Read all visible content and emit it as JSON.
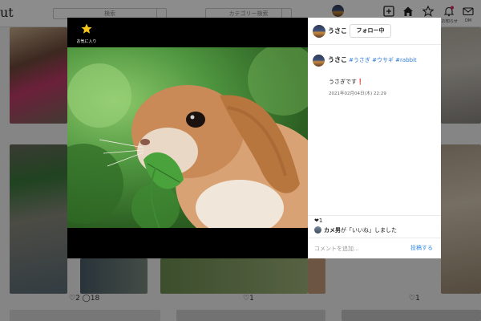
{
  "app": {
    "logo_text": "ut"
  },
  "header": {
    "search_placeholder": "検索",
    "category_placeholder": "カテゴリー検索",
    "nav": [
      {
        "label": "",
        "icon": "plus-square-icon"
      },
      {
        "label": "",
        "icon": "home-icon"
      },
      {
        "label": "",
        "icon": "star-icon"
      },
      {
        "label": "お知らせ",
        "icon": "bell-icon"
      },
      {
        "label": "DM",
        "icon": "mail-icon"
      }
    ]
  },
  "grid_meta": {
    "item1_stats": "♡2 ◯18",
    "item2_stats": "♡1",
    "item3_stats": "♡1"
  },
  "modal": {
    "favorite_label": "お気に入り",
    "author": "うさこ",
    "follow_label": "フォロー中",
    "post_author": "うさこ",
    "hashtags": "#うさぎ #ウサギ #rabbit",
    "caption": "うさぎです❗",
    "timestamp": "2021年02月04日(木) 22:29",
    "like_count": "❤1",
    "liked_by_user": "カメ男",
    "liked_by_text": "が「いいね」しました",
    "comment_placeholder": "コメントを追加...",
    "post_button": "投稿する"
  },
  "colors": {
    "accent": "#3a8fe8",
    "star": "#f5c518",
    "heart": "#e0245e"
  }
}
